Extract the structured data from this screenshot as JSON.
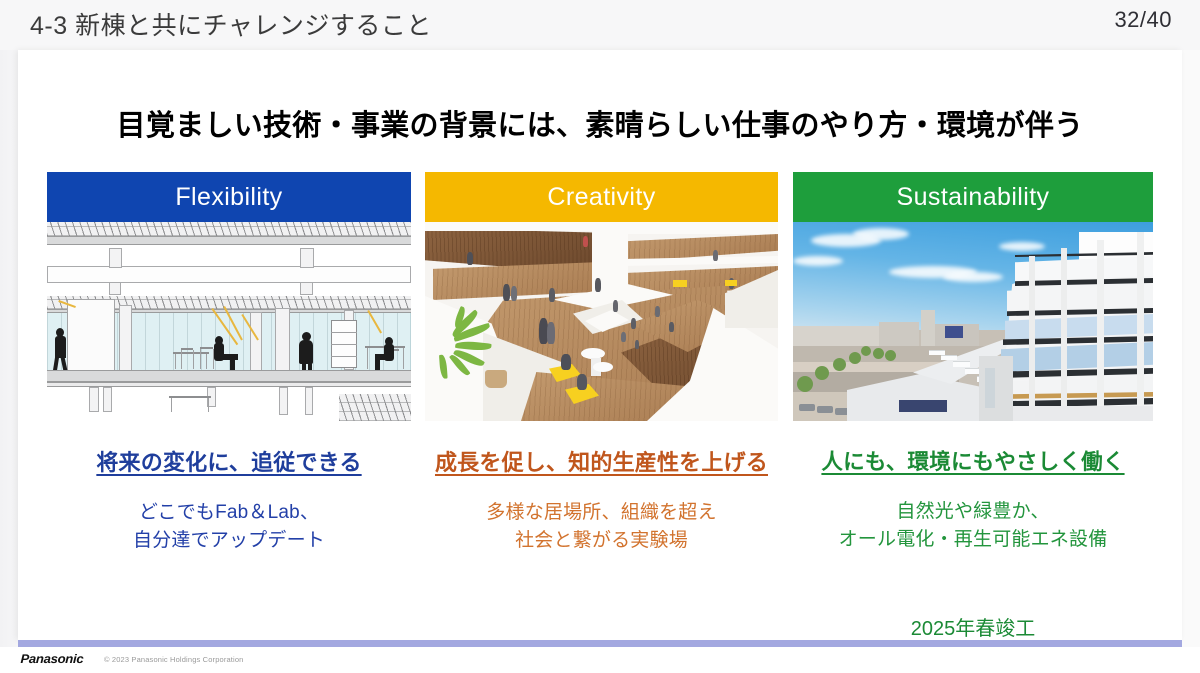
{
  "header": {
    "title": "4-3 新棟と共にチャレンジすること",
    "page_counter": "32/40"
  },
  "slide": {
    "main_heading": "目覚ましい技術・事業の背景には、素晴らしい仕事のやり方・環境が伴う",
    "completion_note": "2025年春竣工",
    "columns": [
      {
        "header_label": "Flexibility",
        "header_color": "#0F45B0",
        "image_name": "architectural-section-drawing",
        "image_alt": "building section drawing with people silhouettes on open floor",
        "caption": "将来の変化に、追従できる",
        "caption_color": "#1F3E9C",
        "body_lines": [
          "どこでもFab＆Lab、",
          "自分達でアップデート"
        ],
        "body_color": "#2340A8"
      },
      {
        "header_label": "Creativity",
        "header_color": "#F5B800",
        "image_name": "atrium-interior-render",
        "image_alt": "multi-level wooden atrium interior with yellow seating and plants",
        "caption": "成長を促し、知的生産性を上げる",
        "caption_color": "#C0561C",
        "body_lines": [
          "多様な居場所、組織を超え",
          "社会と繋がる実験場"
        ],
        "body_color": "#D2732E"
      },
      {
        "header_label": "Sustainability",
        "header_color": "#1E9E3C",
        "image_name": "exterior-campus-render",
        "image_alt": "exterior render of open white building under blue sky",
        "caption": "人にも、環境にもやさしく働く",
        "caption_color": "#1B8A35",
        "body_lines": [
          "自然光や緑豊か、",
          "オール電化・再生可能エネ設備"
        ],
        "body_color": "#23953D"
      }
    ]
  },
  "footer": {
    "logo_text": "Panasonic",
    "copyright": "© 2023 Panasonic Holdings Corporation",
    "accent_bar_color": "#A3A8E0"
  }
}
